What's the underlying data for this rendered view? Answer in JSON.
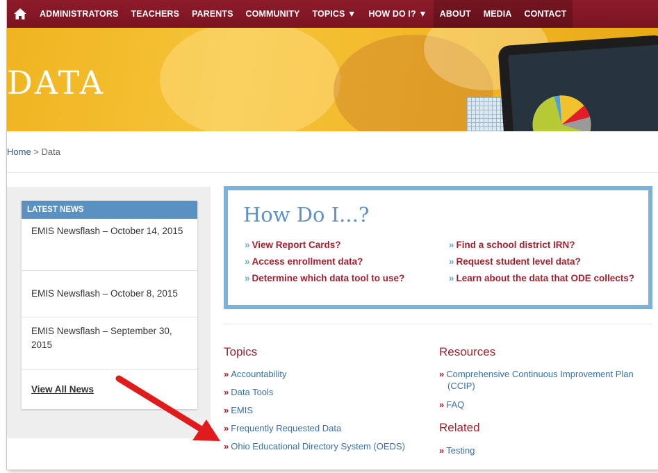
{
  "nav": {
    "items": [
      "ADMINISTRATORS",
      "TEACHERS",
      "PARENTS",
      "COMMUNITY",
      "TOPICS ▼",
      "HOW DO I? ▼",
      "ABOUT",
      "MEDIA",
      "CONTACT"
    ]
  },
  "hero": {
    "title": "DATA"
  },
  "breadcrumb": {
    "home": "Home",
    "separator": " > ",
    "current": "Data"
  },
  "news": {
    "heading": "LATEST NEWS",
    "items": [
      "EMIS Newsflash – October 14, 2015",
      "EMIS Newsflash – October 8, 2015",
      "EMIS Newsflash – September 30, 2015"
    ],
    "view_all": "View All News"
  },
  "howdo": {
    "title": "How Do I...?",
    "chevron": "»",
    "links": [
      "View Report Cards?",
      "Access enrollment data?",
      "Determine which data tool to use?",
      "Find a school district IRN?",
      "Request student level data?",
      "Learn about the data that ODE collects?"
    ]
  },
  "topics": {
    "title": "Topics",
    "chevron": "»",
    "links": [
      "Accountability",
      "Data Tools",
      "EMIS",
      "Frequently Requested Data",
      "Ohio Educational Directory System (OEDS)"
    ]
  },
  "resources": {
    "title": "Resources",
    "links": [
      "Comprehensive Continuous Improvement Plan (CCIP)",
      "FAQ"
    ]
  },
  "related": {
    "title": "Related",
    "links": [
      "Testing"
    ]
  },
  "colors": {
    "nav_bg": "#7a1422",
    "hero_bg": "#f3b92b",
    "accent_red": "#a3212f",
    "accent_blue": "#5d93c6",
    "link_blue": "#3a6fa3",
    "arrow_red": "#e01b1b"
  },
  "icons": {
    "home": "home-icon",
    "arrow": "red-arrow-annotation"
  }
}
